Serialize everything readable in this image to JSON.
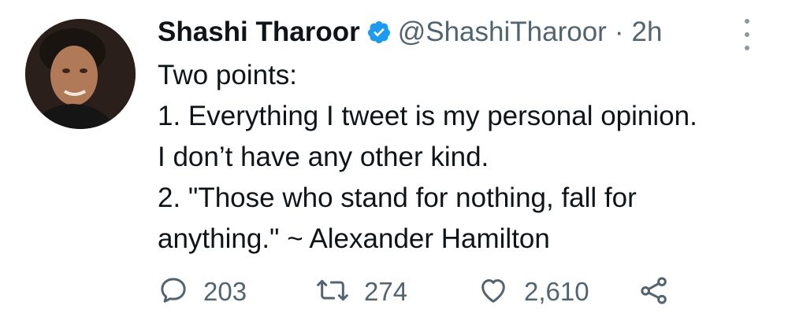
{
  "tweet": {
    "author": {
      "display_name": "Shashi Tharoor",
      "handle": "@ShashiTharoor",
      "verified": true
    },
    "separator": "·",
    "timestamp": "2h",
    "text_lines": [
      "Two points:",
      "1. Everything I tweet is my personal opinion.",
      "I don’t have any other kind.",
      "2. \"Those who stand for nothing, fall for",
      "anything.\" ~ Alexander Hamilton"
    ],
    "stats": {
      "replies": "203",
      "retweets": "274",
      "likes": "2,610"
    }
  },
  "icons": {
    "verified": "verified-badge-icon",
    "more": "more-vertical-icon",
    "reply": "reply-bubble-icon",
    "retweet": "retweet-arrows-icon",
    "like": "heart-icon",
    "share": "share-icon"
  },
  "colors": {
    "text_primary": "#0f1419",
    "text_secondary": "#536471",
    "verified_blue": "#1d9bf0"
  }
}
